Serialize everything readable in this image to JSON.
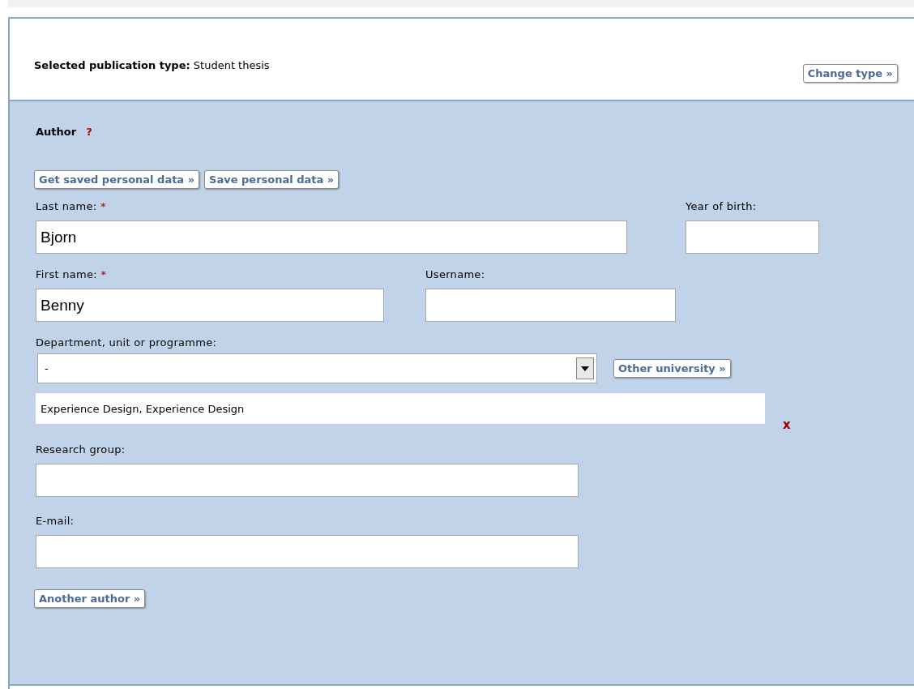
{
  "publication_type": {
    "label": "Selected publication type:",
    "value": "Student thesis",
    "button": "Change type »"
  },
  "author": {
    "title": "Author",
    "help": "?",
    "buttons": [
      "Get saved personal data »",
      "Save personal data »"
    ],
    "last_name": {
      "label": "Last name:",
      "required_mark": "*",
      "value": "Bjorn"
    },
    "year_of_birth": {
      "label": "Year of birth:"
    },
    "first_name": {
      "label": "First name:",
      "required_mark": "*",
      "value": "Benny"
    },
    "username": {
      "label": "Username:"
    },
    "department": {
      "label": "Department, unit or programme:",
      "value": "-",
      "button": "Other university »"
    },
    "selected_department": {
      "value": "Experience Design, Experience Design",
      "remove": "x"
    },
    "research_group": {
      "label": "Research group:"
    },
    "email": {
      "label": "E-mail:"
    },
    "another_button": "Another author »"
  }
}
